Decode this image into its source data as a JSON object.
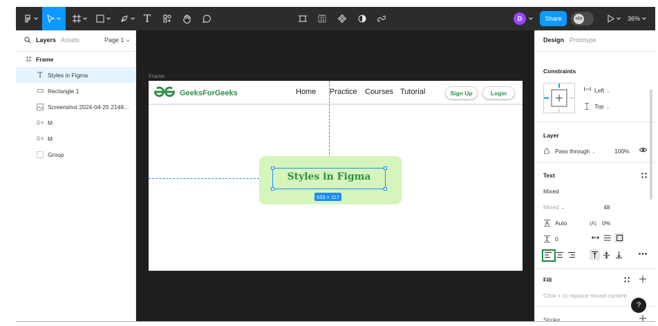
{
  "toolbar": {
    "avatar_initial": "D",
    "share_label": "Share",
    "zoom": "36%",
    "icons": [
      "figma-main-menu-icon",
      "move-tool-icon",
      "frame-tool-icon",
      "shape-tool-icon",
      "pen-tool-icon",
      "text-tool-icon",
      "resources-icon",
      "hand-tool-icon",
      "comment-icon",
      "component-tools-icon",
      "grid-icon",
      "component-icon",
      "contrast-icon",
      "link-icon",
      "dev-mode-icon",
      "present-icon"
    ],
    "accent": "#0d99ff"
  },
  "left_panel": {
    "tabs": {
      "layers": "Layers",
      "assets": "Assets"
    },
    "page": "Page 1",
    "layers": [
      {
        "label": "Frame",
        "icon": "frame-icon"
      },
      {
        "label": "Styles in Figma",
        "icon": "text-icon",
        "selected": true
      },
      {
        "label": "Rectangle 1",
        "icon": "rectangle-icon"
      },
      {
        "label": "Screenshot 2024-04-25 2148...",
        "icon": "image-icon"
      },
      {
        "label": "M",
        "icon": "autolayout-icon"
      },
      {
        "label": "M",
        "icon": "autolayout-icon"
      },
      {
        "label": "Group",
        "icon": "group-icon"
      }
    ]
  },
  "canvas": {
    "frame_label": "Frame",
    "site": {
      "brand": "GeeksForGeeks",
      "brand_color": "#2f8d46",
      "nav_links": [
        "Home",
        "Practice",
        "Courses",
        "Tutorial"
      ],
      "signup": "Sign Up",
      "login": "Login"
    },
    "hero_text": "Styles in Figma",
    "selection_size": "633 × 117"
  },
  "right_panel": {
    "tabs": {
      "design": "Design",
      "prototype": "Prototype"
    },
    "constraints": {
      "title": "Constraints",
      "horizontal": "Left",
      "vertical": "Top"
    },
    "layer": {
      "title": "Layer",
      "blend": "Pass through",
      "opacity": "100%"
    },
    "text": {
      "title": "Text",
      "font_family": "Mixed",
      "font_style": "Mixed",
      "font_size": "48",
      "line_height": "Auto",
      "letter_spacing": "0%",
      "paragraph_spacing": "0"
    },
    "fill": {
      "title": "Fill",
      "hint": "Click + to replace mixed content"
    },
    "stroke": {
      "title": "Stroke"
    },
    "help": "?"
  }
}
